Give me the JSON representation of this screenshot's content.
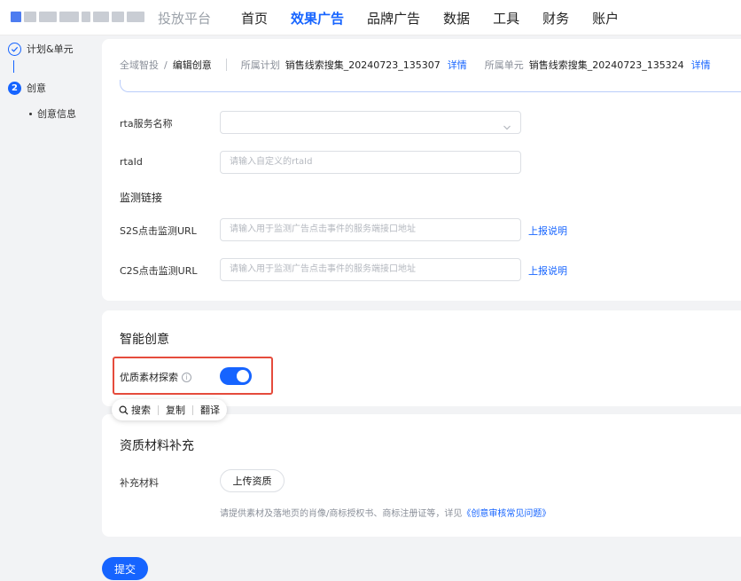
{
  "header": {
    "brand": "投放平台",
    "nav": [
      {
        "label": "首页",
        "active": false
      },
      {
        "label": "效果广告",
        "active": true
      },
      {
        "label": "品牌广告",
        "active": false
      },
      {
        "label": "数据",
        "active": false
      },
      {
        "label": "工具",
        "active": false
      },
      {
        "label": "财务",
        "active": false
      },
      {
        "label": "账户",
        "active": false
      }
    ]
  },
  "sidebar": {
    "step1": {
      "label": "计划&单元",
      "icon": "check-icon"
    },
    "step2": {
      "num": "2",
      "label": "创意"
    },
    "sub_item": "创意信息"
  },
  "breadcrumb": {
    "root": "全域智投",
    "sep": "/",
    "current": "编辑创意",
    "plan_label": "所属计划",
    "plan_value": "销售线索搜集_20240723_135307",
    "plan_link": "详情",
    "unit_label": "所属单元",
    "unit_value": "销售线索搜集_20240723_135324",
    "unit_link": "详情"
  },
  "form": {
    "rta_service_label": "rta服务名称",
    "rta_service_value": "",
    "rtaid_label": "rtaId",
    "rtaid_placeholder": "请输入自定义的rtaId",
    "monitor_title": "监测链接",
    "s2s_label": "S2S点击监测URL",
    "s2s_placeholder": "请输入用于监测广告点击事件的服务端接口地址",
    "s2s_help": "上报说明",
    "c2s_label": "C2S点击监测URL",
    "c2s_placeholder": "请输入用于监测广告点击事件的服务端接口地址",
    "c2s_help": "上报说明"
  },
  "smart": {
    "title": "智能创意",
    "toggle_label": "优质素材探索",
    "info_glyph": "i",
    "toggle_on": true
  },
  "popup": {
    "search_icon": "search-icon",
    "search": "搜索",
    "copy": "复制",
    "translate": "翻译"
  },
  "qualification": {
    "title": "资质材料补充",
    "label": "补充材料",
    "upload": "上传资质",
    "hint": "请提供素材及落地页的肖像/商标授权书、商标注册证等，详见",
    "hint_link": "《创意审核常见问题》"
  },
  "submit": "提交",
  "colors": {
    "accent": "#1664ff",
    "highlight_border": "#e54b3c"
  }
}
